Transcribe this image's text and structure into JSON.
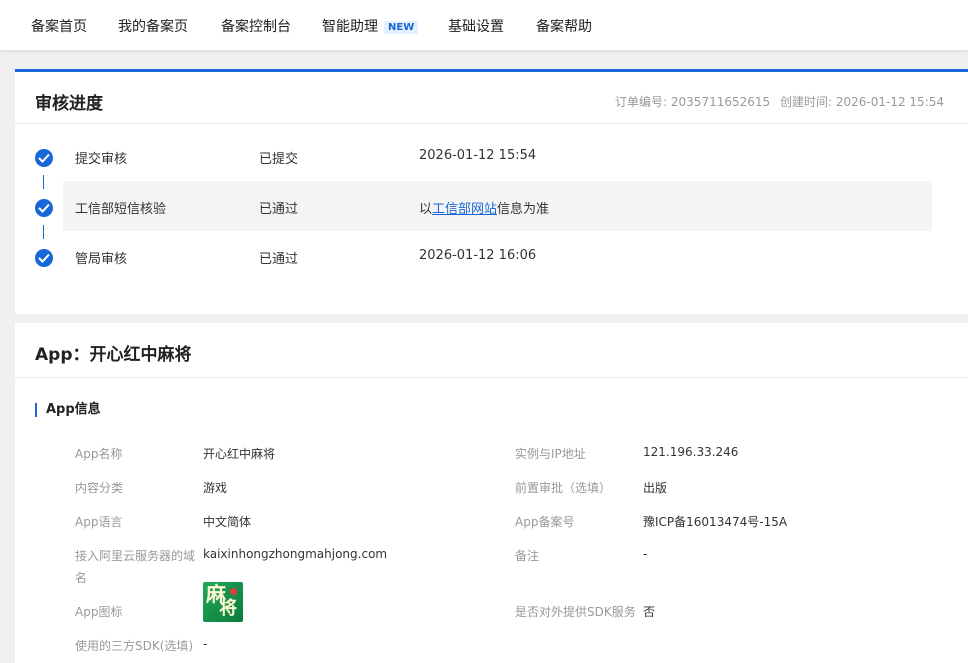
{
  "nav": {
    "items": [
      {
        "label": "备案首页"
      },
      {
        "label": "我的备案页"
      },
      {
        "label": "备案控制台"
      },
      {
        "label": "智能助理",
        "badge": "NEW"
      },
      {
        "label": "基础设置"
      },
      {
        "label": "备案帮助"
      }
    ]
  },
  "review": {
    "title": "审核进度",
    "order_no": "订单编号: 2035711652615",
    "created": "创建时间: 2026-01-12 15:54",
    "steps": [
      {
        "name": "提交审核",
        "status": "已提交",
        "info": "2026-01-12 15:54"
      },
      {
        "name": "工信部短信核验",
        "status": "已通过",
        "info_prefix": "以",
        "info_link": "工信部网站",
        "info_suffix": "信息为准"
      },
      {
        "name": "管局审核",
        "status": "已通过",
        "info": "2026-01-12 16:06"
      }
    ]
  },
  "app": {
    "title": "App：开心红中麻将",
    "section_title": "App信息",
    "left": [
      {
        "label": "App名称",
        "value": "开心红中麻将"
      },
      {
        "label": "内容分类",
        "value": "游戏"
      },
      {
        "label": "App语言",
        "value": "中文简体"
      },
      {
        "label_line1": "接入阿里云服务器的域",
        "label_line2": "名",
        "value": "kaixinhongzhongmahjong.com"
      },
      {
        "label": "App图标",
        "icon_name": "app-icon",
        "icon_text": "麻将"
      },
      {
        "label": "使用的三方SDK(选填)",
        "value": "-"
      }
    ],
    "right": [
      {
        "label": "实例与IP地址",
        "value": "121.196.33.246"
      },
      {
        "label": "前置审批（选填）",
        "value": "出版"
      },
      {
        "label": "App备案号",
        "value": "豫ICP备16013474号-15A"
      },
      {
        "label": "备注",
        "value": "-"
      },
      {
        "label": "是否对外提供SDK服务",
        "value": "否"
      }
    ]
  },
  "colors": {
    "accent": "#1867d6",
    "muted": "#999999",
    "highlight_row": "#f4f4f4"
  }
}
